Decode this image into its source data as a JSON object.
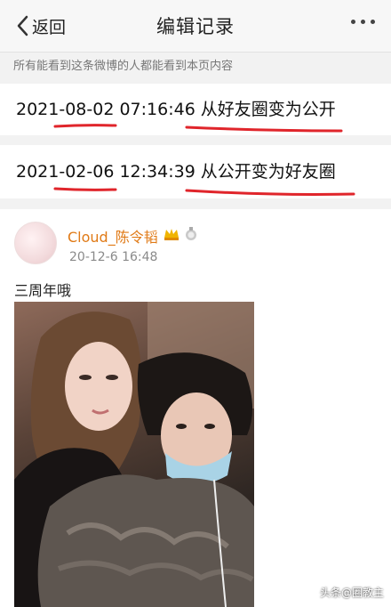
{
  "nav": {
    "back_label": "返回",
    "title": "编辑记录"
  },
  "notice": "所有能看到这条微博的人都能看到本页内容",
  "records": [
    {
      "time": "2021-08-02 07:16:46",
      "action": "从好友圈变为公开"
    },
    {
      "time": "2021-02-06 12:34:39",
      "action": "从公开变为好友圈"
    }
  ],
  "post": {
    "username": "Cloud_陈令韬",
    "time": "20-12-6 16:48",
    "text": "三周年哦"
  },
  "watermark": "头条@圈教主",
  "colors": {
    "annotation_red": "#e0252b",
    "username_orange": "#e07a16"
  }
}
